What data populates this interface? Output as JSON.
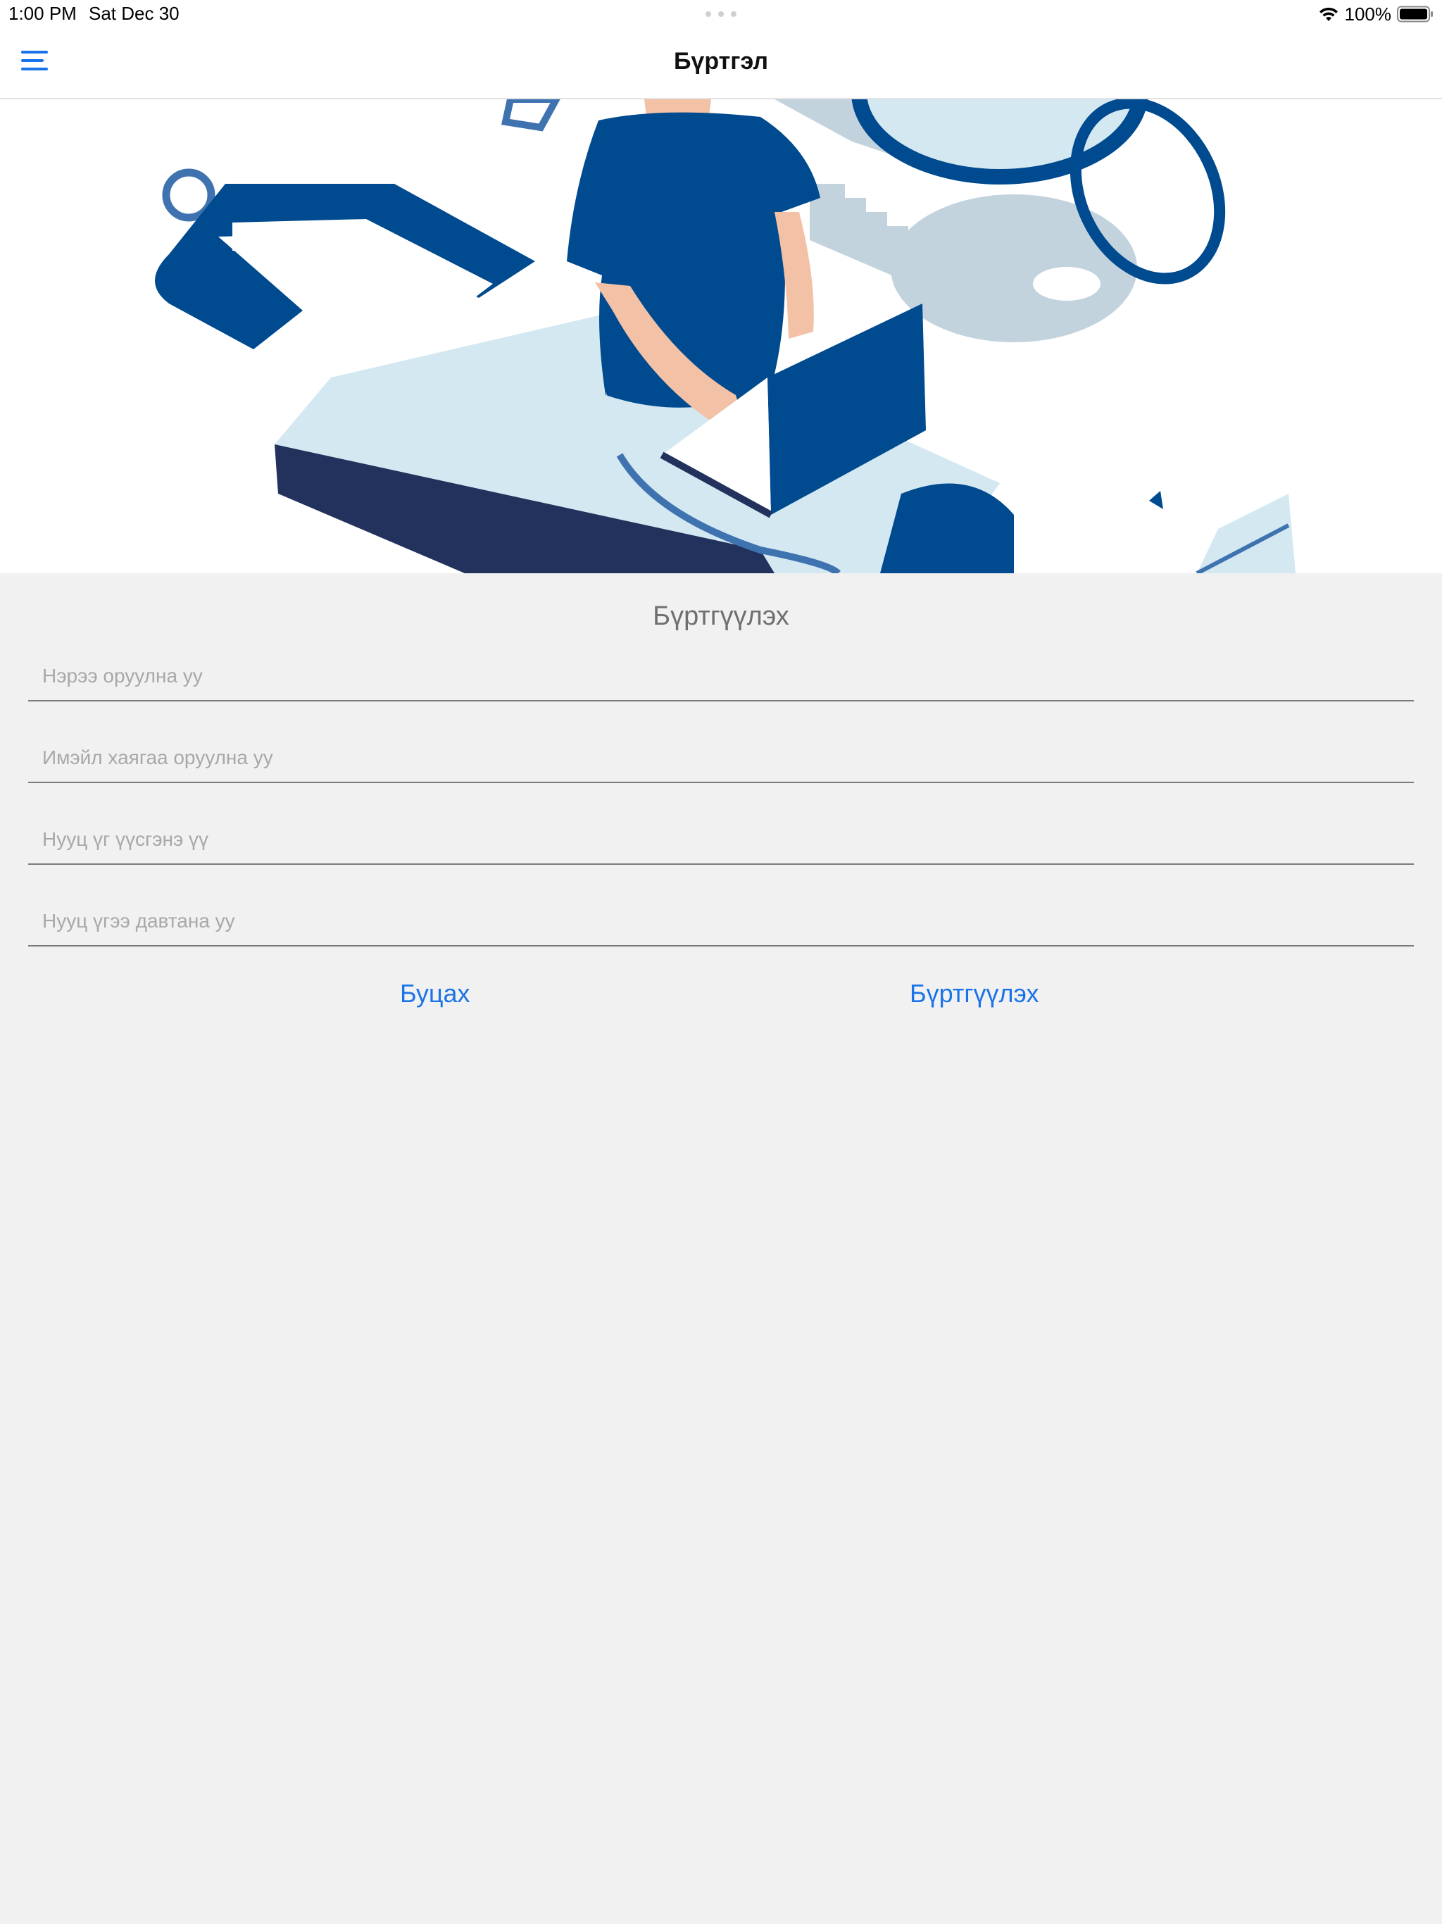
{
  "status_bar": {
    "time": "1:00 PM",
    "date": "Sat Dec 30",
    "battery_percent": "100%",
    "wifi_icon": "wifi-icon",
    "battery_icon": "battery-icon"
  },
  "nav": {
    "title": "Бүртгэл",
    "menu_icon": "hamburger-menu-icon"
  },
  "hero": {
    "image": "person-with-laptop-illustration"
  },
  "form": {
    "title": "Бүртгүүлэх",
    "fields": [
      {
        "name": "name",
        "placeholder": "Нэрээ оруулна уу",
        "value": ""
      },
      {
        "name": "email",
        "placeholder": "Имэйл хаягаа оруулна уу",
        "value": ""
      },
      {
        "name": "password",
        "placeholder": "Нууц үг үүсгэнэ үү",
        "value": ""
      },
      {
        "name": "confirm_password",
        "placeholder": "Нууц үгээ давтана уу",
        "value": ""
      }
    ],
    "back_label": "Буцах",
    "register_label": "Бүртгүүлэх"
  },
  "colors": {
    "accent": "#1a73e8",
    "illustration_navy": "#004a8f",
    "illustration_light": "#d4e8f2",
    "illustration_grey": "#c3d3dd",
    "background": "#f1f1f1"
  }
}
